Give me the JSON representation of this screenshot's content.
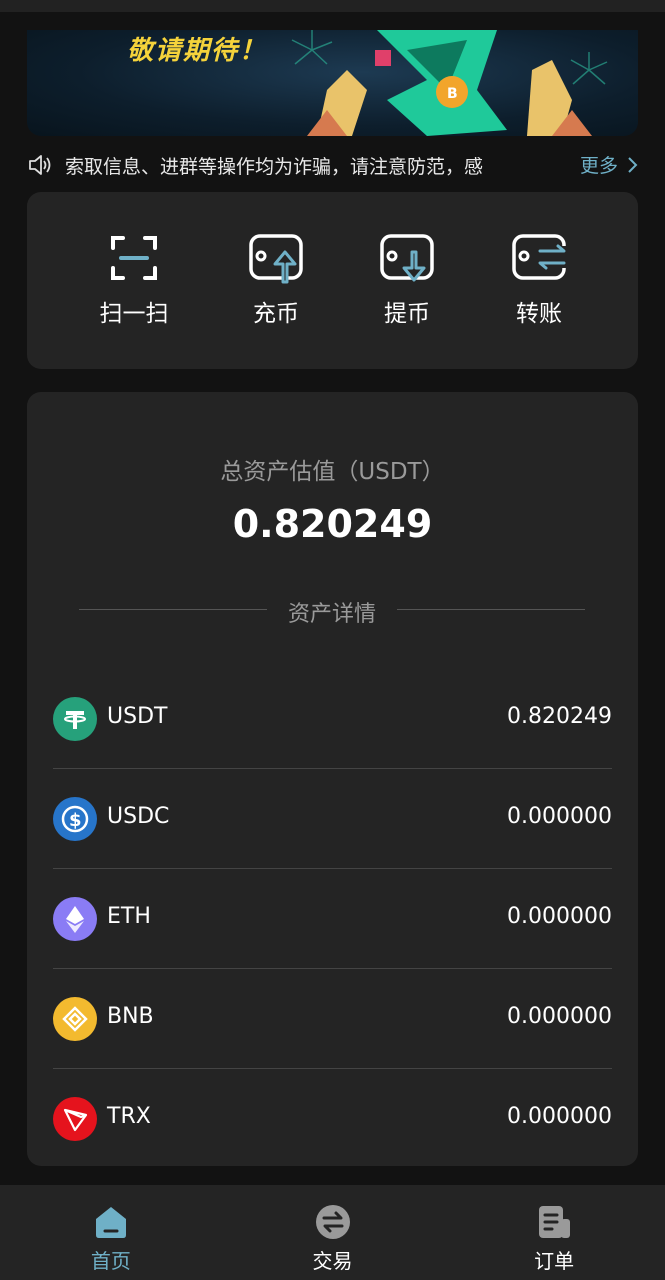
{
  "banner": {
    "text": "敬请期待！"
  },
  "notice": {
    "text": "索取信息、进群等操作均为诈骗，请注意防范，感",
    "more_label": "更多"
  },
  "actions": [
    {
      "label": "扫一扫",
      "icon": "scan-icon"
    },
    {
      "label": "充币",
      "icon": "deposit-icon"
    },
    {
      "label": "提币",
      "icon": "withdraw-icon"
    },
    {
      "label": "转账",
      "icon": "transfer-icon"
    }
  ],
  "assets": {
    "total_label": "总资产估值（USDT）",
    "total_value": "0.820249",
    "detail_label": "资产详情",
    "items": [
      {
        "symbol": "USDT",
        "amount": "0.820249",
        "color": "#26a17b"
      },
      {
        "symbol": "USDC",
        "amount": "0.000000",
        "color": "#2775ca"
      },
      {
        "symbol": "ETH",
        "amount": "0.000000",
        "color": "#8a7cf5"
      },
      {
        "symbol": "BNB",
        "amount": "0.000000",
        "color": "#f3ba2f"
      },
      {
        "symbol": "TRX",
        "amount": "0.000000",
        "color": "#e5131d"
      }
    ]
  },
  "tabs": [
    {
      "label": "首页",
      "active": true
    },
    {
      "label": "交易",
      "active": false
    },
    {
      "label": "订单",
      "active": false
    }
  ],
  "colors": {
    "accent": "#6fb0c7",
    "card": "#242424",
    "background": "#121212"
  }
}
